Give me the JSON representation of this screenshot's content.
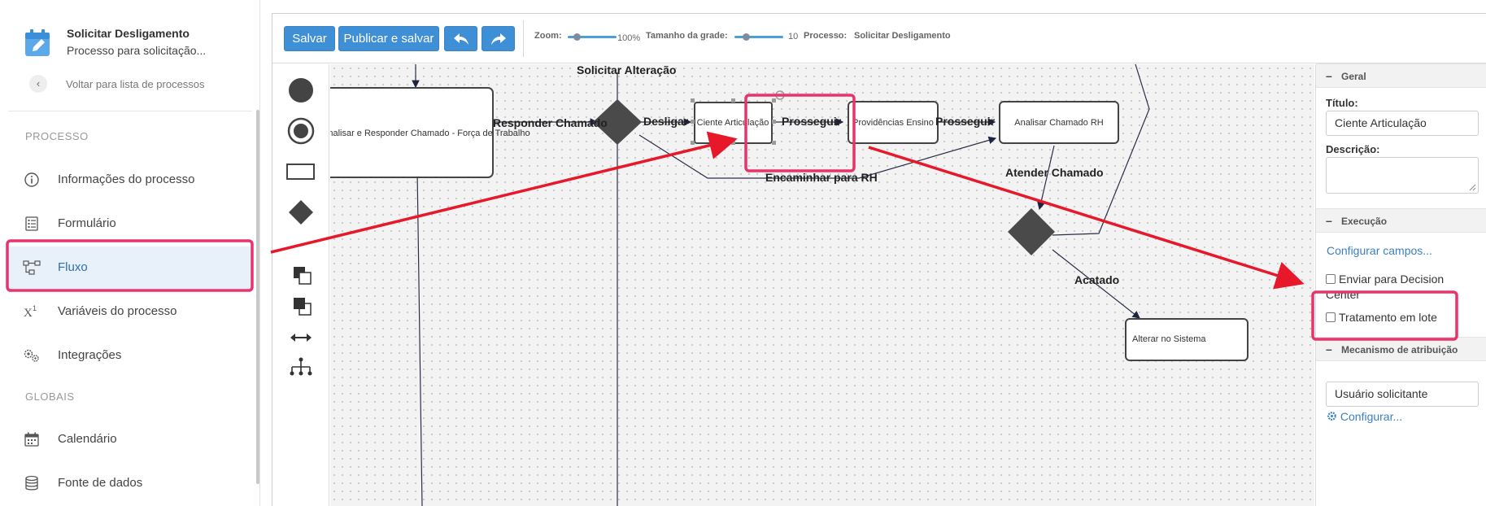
{
  "process": {
    "title": "Solicitar Desligamento",
    "subtitle": "Processo para solicitação...",
    "back_label": "Voltar para lista de processos"
  },
  "sidebar": {
    "section_process": "PROCESSO",
    "section_global": "GLOBAIS",
    "items": [
      {
        "label": "Informações do processo",
        "icon": "info-icon"
      },
      {
        "label": "Formulário",
        "icon": "form-icon"
      },
      {
        "label": "Fluxo",
        "icon": "flow-icon",
        "active": true
      },
      {
        "label": "Variáveis do processo",
        "icon": "variable-icon"
      },
      {
        "label": "Integrações",
        "icon": "gears-icon"
      }
    ],
    "global_items": [
      {
        "label": "Calendário",
        "icon": "calendar-icon"
      },
      {
        "label": "Fonte de dados",
        "icon": "database-icon"
      }
    ]
  },
  "toolbar": {
    "save_label": "Salvar",
    "publish_label": "Publicar e salvar",
    "zoom_label": "Zoom:",
    "zoom_value": "100%",
    "zoom_level": 1.0,
    "grid_label": "Tamanho da grade:",
    "grid_value": "10",
    "process_label": "Processo:",
    "process_value": "Solicitar Desligamento"
  },
  "flow": {
    "nodes": {
      "analisar_responder": "Analisar e Responder Chamado  - Força de Trabalho",
      "ciente_articulacao": "Ciente Articulação",
      "providencias_ensino": "Providências Ensino",
      "analisar_rh": "Analisar Chamado RH",
      "alterar_sistema": "Alterar no Sistema"
    },
    "edges": {
      "solicitar_alteracao": "Solicitar Alteração",
      "responder_chamado": "Responder Chamado",
      "desligar": "Desligar",
      "prosseguir_1": "Prosseguir",
      "prosseguir_2": "Prosseguir",
      "encaminhar_rh": "Encaminhar para RH",
      "atender_chamado": "Atender Chamado",
      "acatado": "Acatado"
    }
  },
  "panel": {
    "general_title": "Geral",
    "title_label": "Título:",
    "title_value": "Ciente Articulação",
    "description_label": "Descrição:",
    "execution_title": "Execução",
    "configure_fields": "Configurar campos...",
    "decision_center_label": "Enviar para Decision Center",
    "batch_label": "Tratamento em lote",
    "assignment_title": "Mecanismo de atribuição",
    "assignment_value": "Usuário solicitante",
    "configure_label": "Configurar...",
    "section_toggle": "–"
  },
  "colors": {
    "accent": "#3f8fd6",
    "annotation": "#e8182b",
    "highlight": "#e8336b",
    "active_bg": "#e8f1fa"
  }
}
